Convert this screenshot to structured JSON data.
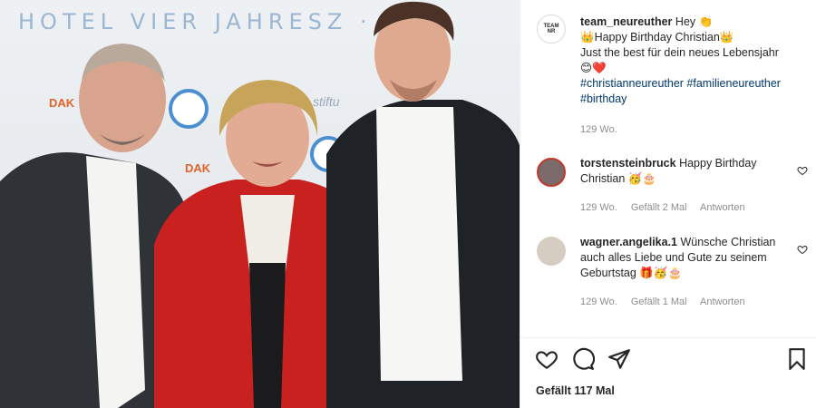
{
  "photo": {
    "wall_text": "HOTEL VIER JAHRESZ · KEM",
    "wall_sub": "stiftu",
    "logo_left": "DAK",
    "logo_mid": "DAK"
  },
  "post": {
    "username": "team_neureuther",
    "caption_line1": "Hey 👏",
    "caption_line2": "👑Happy Birthday Christian👑",
    "caption_line3": "Just the best für dein neues Lebensjahr",
    "caption_line4": "😊❤️",
    "hashtags": "#christianneureuther #familieneureuther #birthday",
    "age": "129 Wo."
  },
  "comments": [
    {
      "username": "torstensteinbruck",
      "text": "Happy Birthday Christian 🥳🎂",
      "age": "129 Wo.",
      "likes": "Gefällt 2 Mal",
      "reply": "Antworten"
    },
    {
      "username": "wagner.angelika.1",
      "text": "Wünsche Christian auch alles Liebe und Gute zu seinem Geburtstag 🎁🥳🎂",
      "age": "129 Wo.",
      "likes": "Gefällt 1 Mal",
      "reply": "Antworten"
    }
  ],
  "actions": {
    "likes_label": "Gefällt 117 Mal"
  },
  "icons": {
    "like": "heart-icon",
    "comment": "comment-icon",
    "share": "share-icon",
    "save": "bookmark-icon"
  },
  "colors": {
    "hashtag": "#00376b",
    "meta": "#8e8e8e",
    "text": "#262626"
  }
}
